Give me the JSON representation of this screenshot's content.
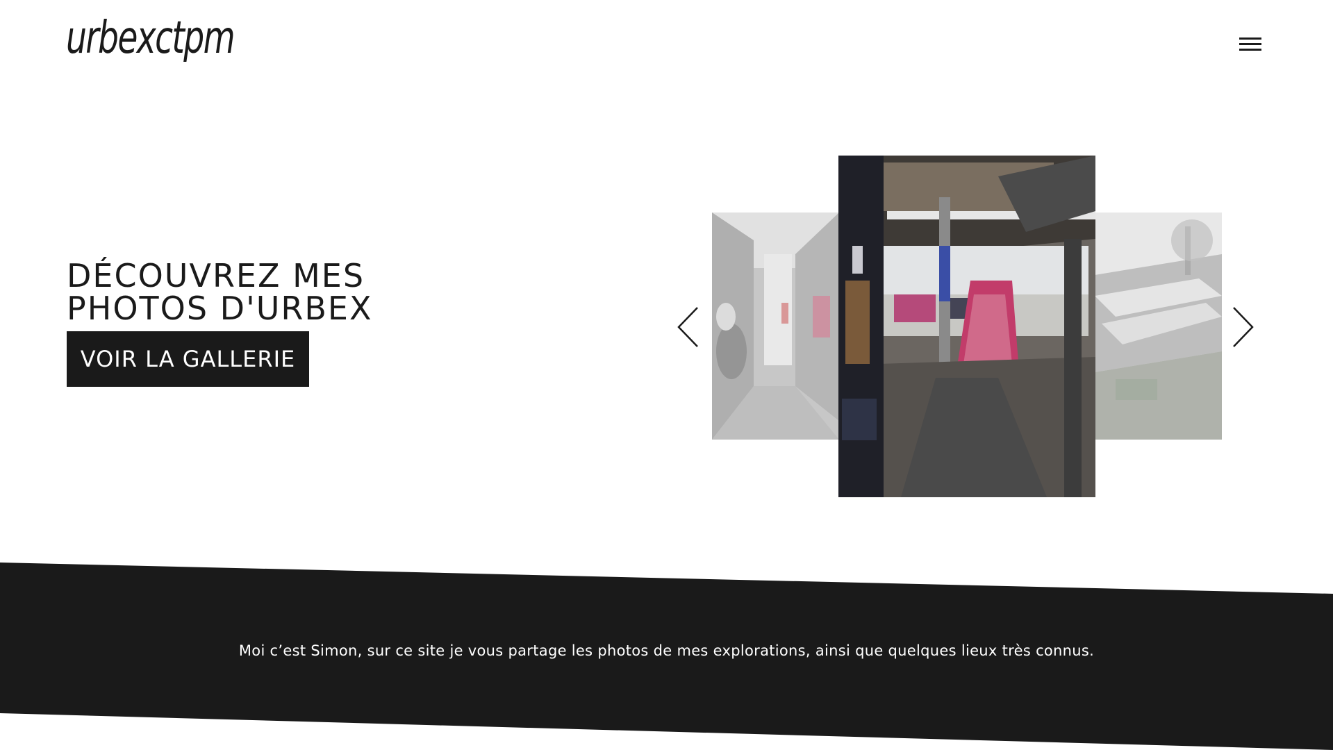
{
  "header": {
    "logo": "urbexctpm",
    "menu_icon": "hamburger-menu-icon"
  },
  "hero": {
    "title": "DÉCOUVREZ MES PHOTOS D'URBEX",
    "cta_label": "VOIR LA GALLERIE"
  },
  "carousel": {
    "prev_icon": "chevron-left-icon",
    "next_icon": "chevron-right-icon",
    "slides": [
      {
        "position": "previous",
        "subject": "graffiti corridor"
      },
      {
        "position": "current",
        "subject": "abandoned hall with graffiti staircase"
      },
      {
        "position": "next",
        "subject": "abandoned rooftops"
      }
    ]
  },
  "about": {
    "text": "Moi c’est Simon, sur ce site je vous partage les photos de mes explorations, ainsi que quelques lieux très connus."
  },
  "colors": {
    "dark": "#1a1a1a",
    "background": "#ffffff"
  }
}
